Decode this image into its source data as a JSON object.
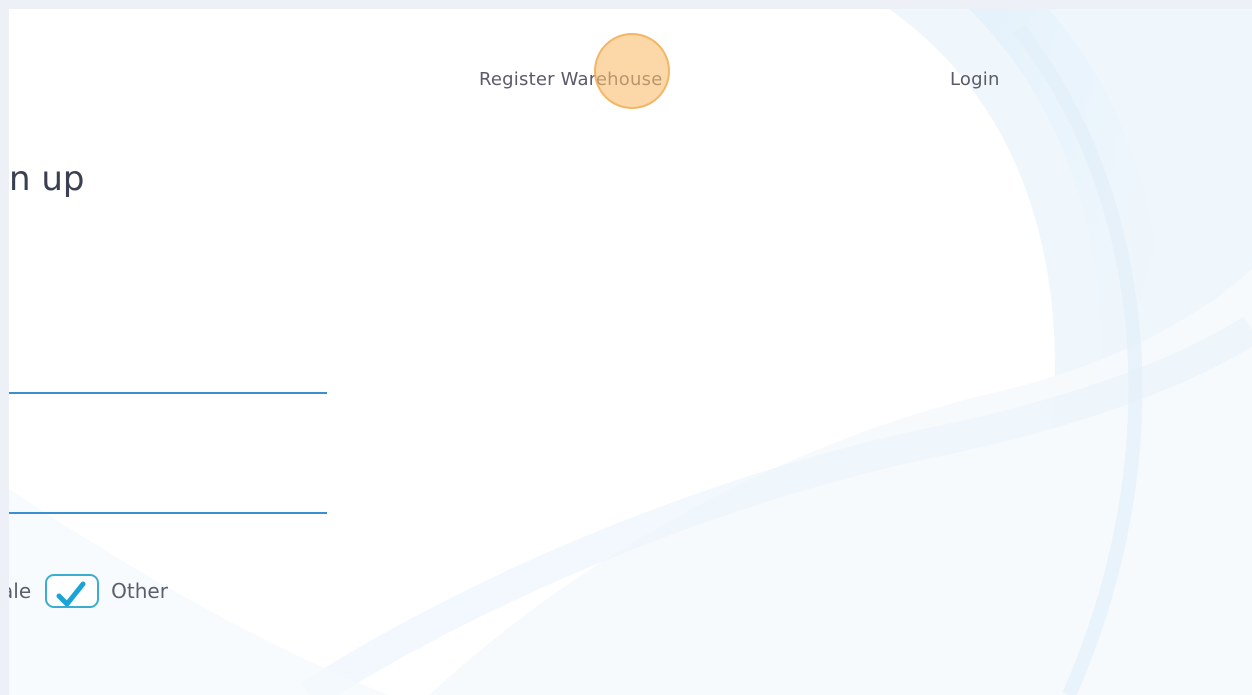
{
  "nav": {
    "register_label": "Register Warehouse",
    "login_label": "Login"
  },
  "form": {
    "title": "n up",
    "field_1_value": "",
    "field_2_value": "",
    "gender": {
      "partial_label": "ale",
      "other_label": "Other",
      "other_checked": true
    }
  },
  "colors": {
    "accent_line": "#3a8fd0",
    "checkbox_border": "#3aaed0",
    "check_mark": "#1aa3d6",
    "click_marker": "#fabe6e"
  },
  "icons": {
    "check": "check-icon"
  }
}
